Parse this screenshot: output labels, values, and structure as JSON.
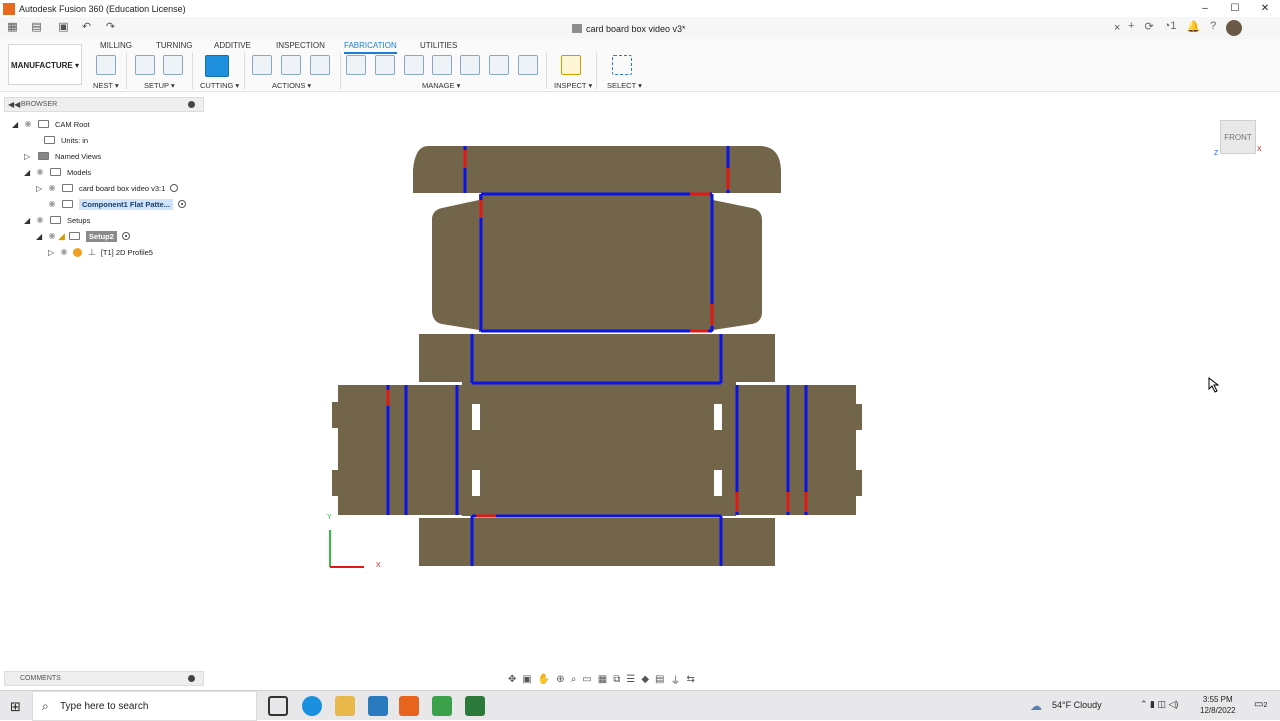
{
  "window": {
    "title": "Autodesk Fusion 360 (Education License)",
    "controls": [
      "–",
      "☐",
      "✕"
    ]
  },
  "document": {
    "title": "card board box video v3*",
    "close": "×"
  },
  "qab_right": {
    "jobs_count": "1",
    "add": "+",
    "help": "?"
  },
  "workspace": {
    "label": "MANUFACTURE ▾"
  },
  "tabs": [
    "MILLING",
    "TURNING",
    "ADDITIVE",
    "INSPECTION",
    "FABRICATION",
    "UTILITIES"
  ],
  "active_tab": "FABRICATION",
  "groups": {
    "nest": "NEST ▾",
    "setup": "SETUP ▾",
    "cutting": "CUTTING ▾",
    "actions": "ACTIONS ▾",
    "manage": "MANAGE ▾",
    "inspect": "INSPECT ▾",
    "select": "SELECT ▾"
  },
  "browser": {
    "title": "BROWSER",
    "nodes": [
      {
        "label": "CAM Root"
      },
      {
        "label": "Units: in"
      },
      {
        "label": "Named Views"
      },
      {
        "label": "Models"
      },
      {
        "label": "card board box video v3:1"
      },
      {
        "label": "Component1 Flat Patte..."
      },
      {
        "label": "Setups"
      },
      {
        "label": "Setup2"
      },
      {
        "label": "[T1] 2D Profile5"
      }
    ]
  },
  "viewcube": {
    "face": "FRONT"
  },
  "axes": {
    "x": "X",
    "y": "Y",
    "z": "Z"
  },
  "comments": {
    "title": "COMMENTS"
  },
  "taskbar": {
    "search_placeholder": "Type here to search",
    "weather": "54°F  Cloudy",
    "time": "3:55 PM",
    "date": "12/8/2022",
    "notifications": "2"
  },
  "colors": {
    "cardboard": "#73654a",
    "cut_blue": "#0a14e6",
    "lead_red": "#e01818",
    "active_tab": "#1a7ed6"
  }
}
